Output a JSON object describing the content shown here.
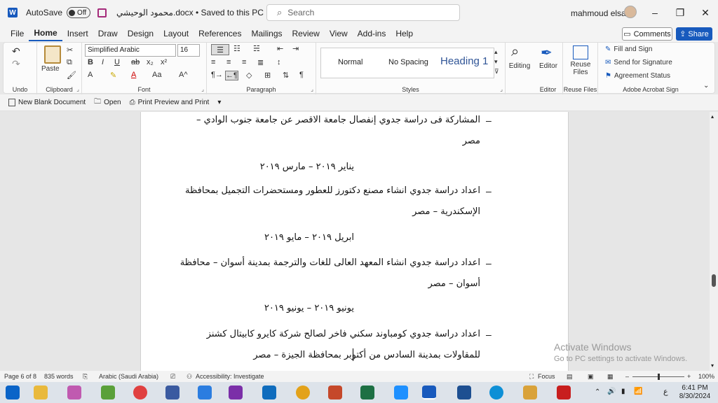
{
  "titlebar": {
    "app_icon": "W",
    "autosave_label": "AutoSave",
    "autosave_state": "Off",
    "doc_title": "محمود الوحيشي.docx • Saved to this PC",
    "search_placeholder": "Search",
    "user_name": "mahmoud elsaid"
  },
  "menu": {
    "items": [
      "File",
      "Home",
      "Insert",
      "Draw",
      "Design",
      "Layout",
      "References",
      "Mailings",
      "Review",
      "View",
      "Add-ins",
      "Help"
    ],
    "active": "Home",
    "comments_label": "Comments",
    "share_label": "Share"
  },
  "ribbon": {
    "groups": {
      "undo": "Undo",
      "clipboard": "Clipboard",
      "font": "Font",
      "paragraph": "Paragraph",
      "styles": "Styles",
      "editor": "Editor",
      "reuse_files": "Reuse Files",
      "acrobat": "Adobe Acrobat Sign"
    },
    "paste_label": "Paste",
    "font_name": "Simplified Arabic",
    "font_size": "16",
    "styles": [
      "Normal",
      "No Spacing",
      "Heading 1"
    ],
    "editing_label": "Editing",
    "editor_label": "Editor",
    "reuse_label": "Reuse Files",
    "acrobat_items": [
      "Fill and Sign",
      "Send for Signature",
      "Agreement Status"
    ]
  },
  "qat": {
    "items": [
      "New Blank Document",
      "Open",
      "Print Preview and Print"
    ]
  },
  "document": {
    "entries": [
      {
        "line1": "المشاركة فى دراسة جدوي إنفصال جامعة الاقصر عن جامعة جنوب الوادي –",
        "line2": "مصر",
        "date": "يناير ٢٠١٩ – مارس ٢٠١٩"
      },
      {
        "line1": "اعداد دراسة جدوي انشاء مصنع دكتورز للعطور ومستحضرات التجميل بمحافظة",
        "line2": "الإسكندرية – مصر",
        "date": "ابريل ٢٠١٩ – مايو ٢٠١٩"
      },
      {
        "line1": "اعداد دراسة جدوي انشاء المعهد العالى للغات والترجمة بمدينة أسوان – محافظة",
        "line2": "أسوان – مصر",
        "date": "يونيو ٢٠١٩ – يونيو ٢٠١٩"
      },
      {
        "line1": "اعداد دراسة جدوي كومباوند سكني فاخر لصالح شركة كايرو كابيتال كشنز",
        "line2": "للمقاولات بمدينة السادس من أكتوبر بمحافظة الجيزة – مصر"
      }
    ],
    "bullet": "–"
  },
  "watermark": {
    "line1": "Activate Windows",
    "line2": "Go to PC settings to activate Windows."
  },
  "status": {
    "page": "Page 6 of 8",
    "words": "835 words",
    "language": "Arabic (Saudi Arabia)",
    "accessibility": "Accessibility: Investigate",
    "focus": "Focus",
    "zoom": "100%"
  },
  "taskbar": {
    "time": "6:41 PM",
    "date": "8/30/2024",
    "lang": "ع"
  },
  "colors": {
    "word_blue": "#185abd",
    "share_blue": "#185abd"
  }
}
